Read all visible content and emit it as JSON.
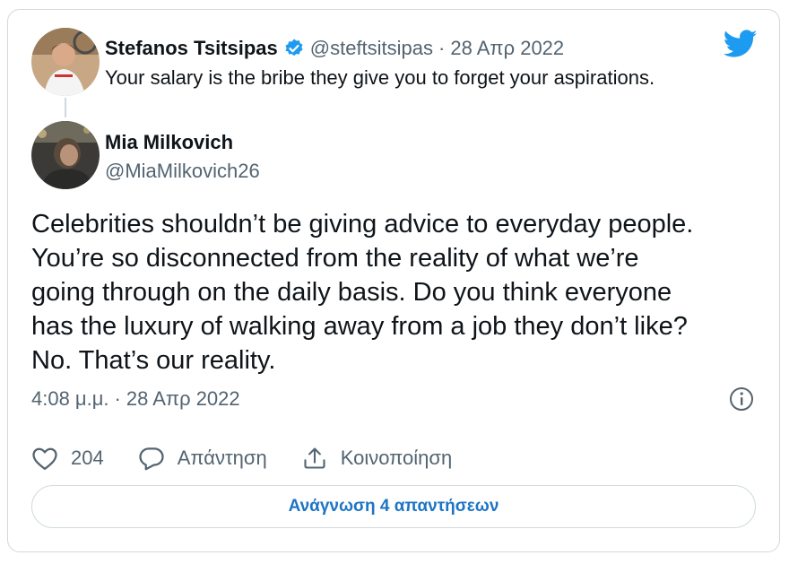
{
  "colors": {
    "brand_blue": "#1d9bf0",
    "link_blue": "#1d74c4",
    "text_primary": "#0f1419",
    "text_secondary": "#536471",
    "border": "#cfd9de"
  },
  "quoted_tweet": {
    "author_name": "Stefanos Tsitsipas",
    "verified_icon": "verified-badge-icon",
    "handle": "@steftsitsipas",
    "separator": "·",
    "date": "28 Απρ 2022",
    "text": "Your salary is the bribe they give you to forget your aspirations."
  },
  "brand_icon": "twitter-bird-icon",
  "tweet": {
    "author_name": "Mia Milkovich",
    "handle": "@MiaMilkovich26",
    "text_lines": [
      "Celebrities shouldn’t be giving advice to everyday people.",
      "You’re so disconnected from the reality of what we’re",
      "going through on the daily basis. Do you think everyone",
      "has the luxury of walking away from a job they don’t like?",
      "No. That’s our reality."
    ],
    "time": "4:08 μ.μ.",
    "separator": "·",
    "date": "28 Απρ 2022",
    "info_icon": "info-icon"
  },
  "actions": {
    "like_icon": "heart-icon",
    "like_count": "204",
    "reply_icon": "reply-bubble-icon",
    "reply_label": "Απάντηση",
    "share_icon": "share-icon",
    "share_label": "Κοινοποίηση"
  },
  "read_replies_label": "Ανάγνωση 4 απαντήσεων"
}
